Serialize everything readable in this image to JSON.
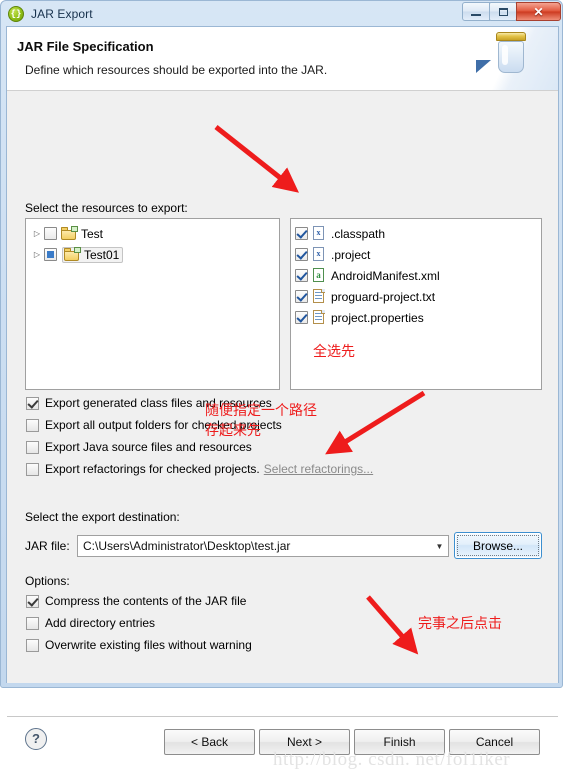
{
  "window": {
    "title": "JAR Export",
    "app_icon": "jar-export-icon",
    "buttons": {
      "minimize": "minimize-icon",
      "maximize": "maximize-icon",
      "close": "✕"
    }
  },
  "banner": {
    "title": "JAR File Specification",
    "description": "Define which resources should be exported into the JAR.",
    "art": "jar-illustration"
  },
  "resources": {
    "label": "Select the resources to export:",
    "tree": [
      {
        "name": "Test",
        "check": "empty",
        "expander": "▷",
        "selected": false
      },
      {
        "name": "Test01",
        "check": "grayed",
        "expander": "▷",
        "selected": true
      }
    ],
    "files": [
      {
        "name": ".classpath",
        "check": "checked",
        "icon": "xml-file-icon",
        "mark": "x"
      },
      {
        "name": ".project",
        "check": "checked",
        "icon": "xml-file-icon",
        "mark": "x"
      },
      {
        "name": "AndroidManifest.xml",
        "check": "checked",
        "icon": "android-manifest-icon",
        "mark": "a"
      },
      {
        "name": "proguard-project.txt",
        "check": "checked",
        "icon": "text-file-icon",
        "mark": ""
      },
      {
        "name": "project.properties",
        "check": "checked",
        "icon": "text-file-icon",
        "mark": ""
      }
    ]
  },
  "export_options": [
    {
      "label": "Export generated class files and resources",
      "checked": true
    },
    {
      "label": "Export all output folders for checked projects",
      "checked": false
    },
    {
      "label": "Export Java source files and resources",
      "checked": false
    },
    {
      "label": "Export refactorings for checked projects.",
      "checked": false,
      "link": "Select refactorings..."
    }
  ],
  "destination": {
    "label": "Select the export destination:",
    "field_label": "JAR file:",
    "value": "C:\\Users\\Administrator\\Desktop\\test.jar",
    "dropdown_arrow": "▼",
    "browse_label": "Browse..."
  },
  "options": {
    "label": "Options:",
    "items": [
      {
        "label": "Compress the contents of the JAR file",
        "checked": true
      },
      {
        "label": "Add directory entries",
        "checked": false
      },
      {
        "label": "Overwrite existing files without warning",
        "checked": false
      }
    ]
  },
  "footer": {
    "help": "?",
    "back": "< Back",
    "next": "Next >",
    "finish": "Finish",
    "cancel": "Cancel"
  },
  "annotations": {
    "select_all": "全选先",
    "path_line1": "随便指定一个路径",
    "path_line2": "存起来先",
    "finish_note": "完事之后点击",
    "arrow_color": "#ee1c1c"
  },
  "watermark": "http://blog. csdn. net/fol1iker"
}
